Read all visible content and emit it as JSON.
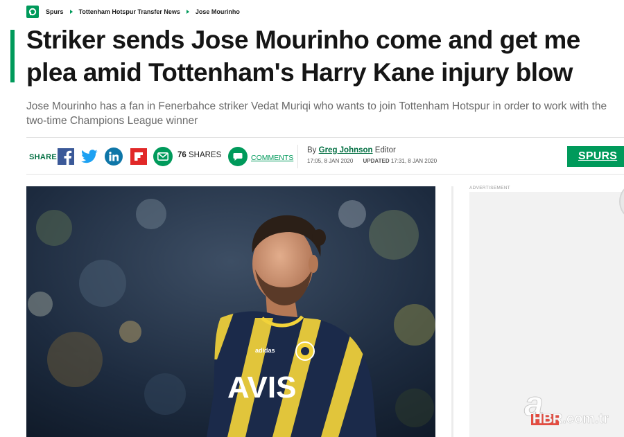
{
  "breadcrumb": {
    "items": [
      "Spurs",
      "Tottenham Hotspur Transfer News",
      "Jose Mourinho"
    ]
  },
  "article": {
    "headline": "Striker sends Jose Mourinho come and get me plea amid Tottenham's Harry Kane injury blow",
    "standfirst": "Jose Mourinho has a fan in Fenerbahce striker Vedat Muriqi who wants to join Tottenham Hotspur in order to work with the two-time Champions League winner"
  },
  "share": {
    "label": "SHARE",
    "count": "76",
    "count_suffix": "SHARES",
    "comments_label": "COMMENTS",
    "icons": [
      "facebook-icon",
      "twitter-icon",
      "linkedin-icon",
      "flipboard-icon",
      "email-icon",
      "comment-icon"
    ]
  },
  "byline": {
    "prefix": "By",
    "author": "Greg Johnson",
    "role": "Editor",
    "published": "17:05, 8 JAN 2020",
    "updated_label": "UPDATED",
    "updated": "17:31, 8 JAN 2020"
  },
  "section_tag": "SPURS",
  "image": {
    "shirt_sponsor": "AVIS",
    "kit_brand": "adidas"
  },
  "sidebar": {
    "ad_label": "ADVERTISEMENT"
  },
  "watermark": {
    "letter": "a",
    "text": "HBR.com.tr"
  },
  "colors": {
    "brand_green": "#009a5b",
    "dark_green": "#006e41",
    "facebook": "#3b5998",
    "twitter": "#1da1f2",
    "linkedin": "#0e76a8",
    "flipboard": "#e12828",
    "kit_navy": "#1b2a4a",
    "kit_yellow": "#f2d33a"
  }
}
